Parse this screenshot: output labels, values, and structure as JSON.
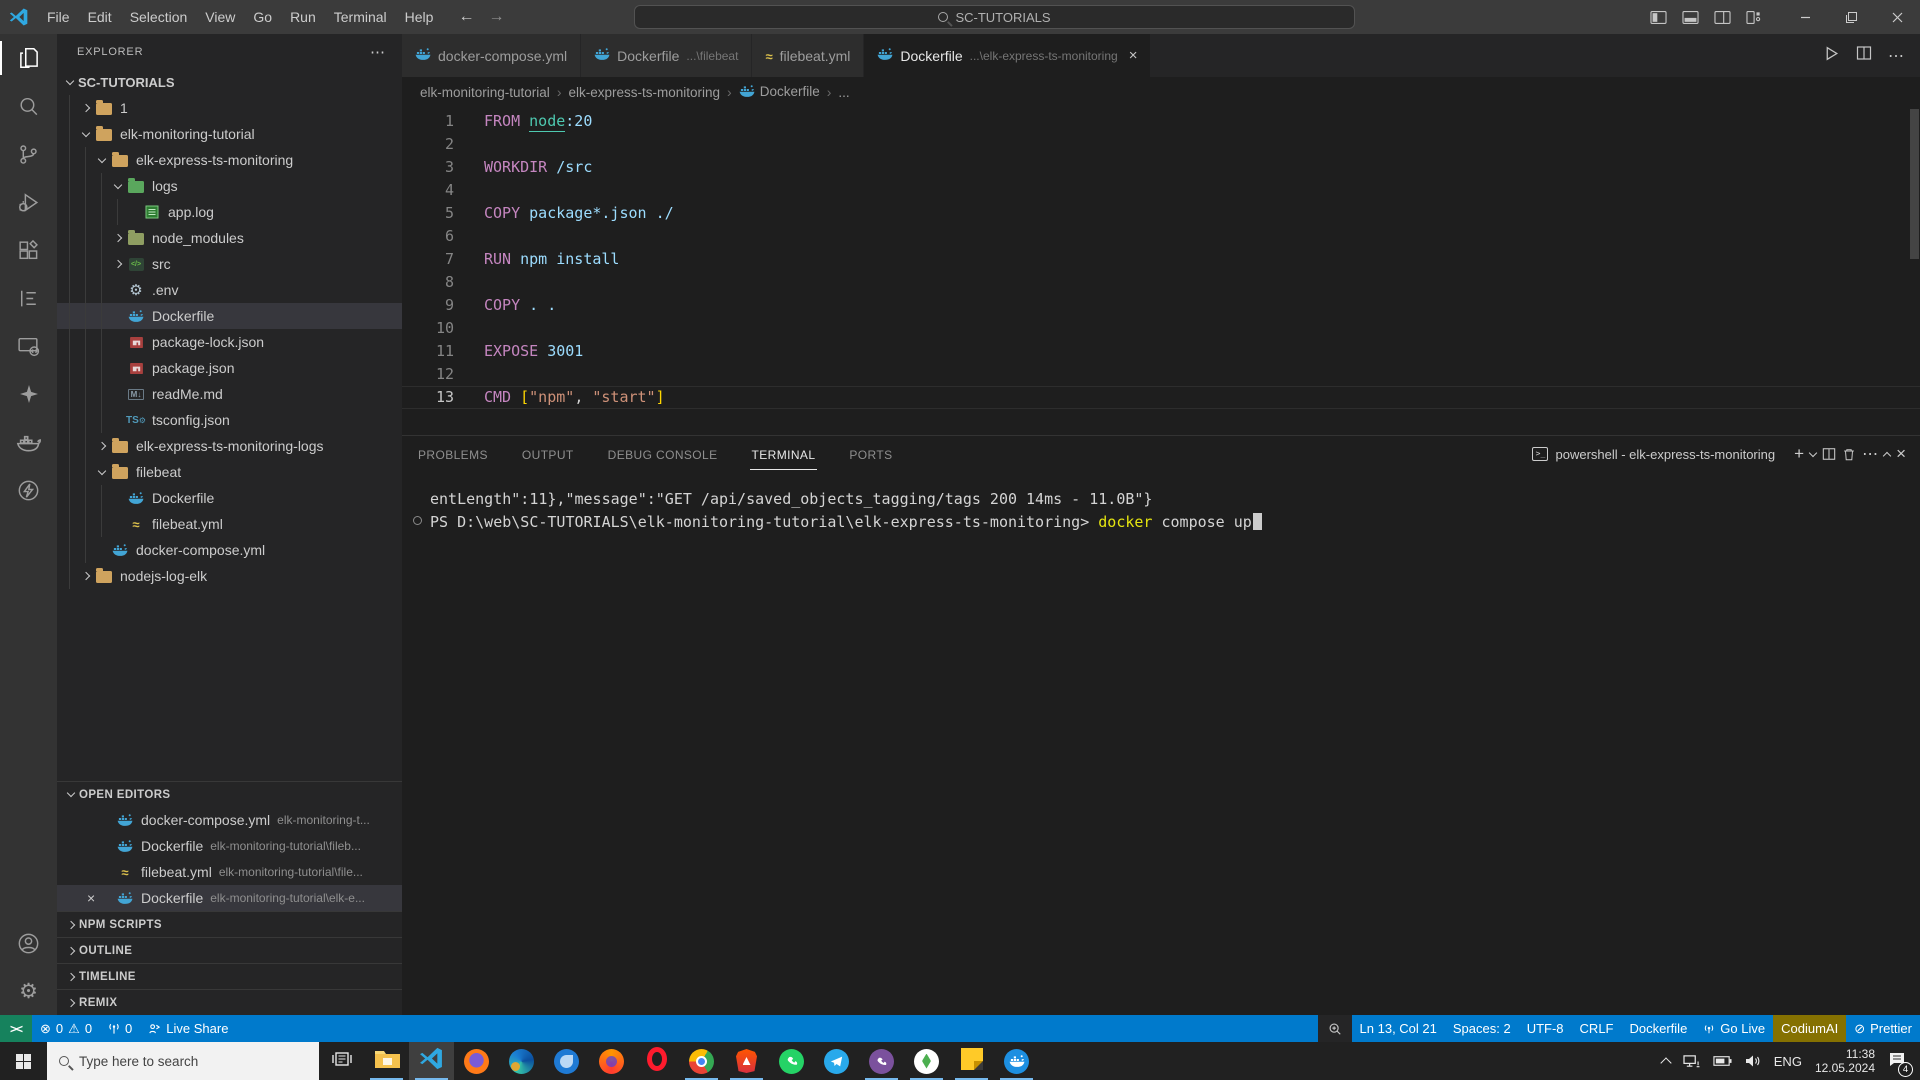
{
  "colors": {
    "accent": "#007acc",
    "remote_bg": "#16825d",
    "codium_bg": "#857101",
    "whale_blue": "#42a5d5",
    "yaml_yellow": "#dcc04c",
    "folder_tan": "#cfa35e",
    "folder_green": "#5aa75d"
  },
  "window": {
    "menus": [
      "File",
      "Edit",
      "Selection",
      "View",
      "Go",
      "Run",
      "Terminal",
      "Help"
    ],
    "search_title": "SC-TUTORIALS",
    "layout_icons": [
      "toggle-primary-sidebar",
      "toggle-panel",
      "toggle-secondary-sidebar",
      "customize-layout"
    ],
    "controls": [
      "minimize",
      "restore",
      "close"
    ]
  },
  "activity_bar": {
    "top": [
      {
        "name": "explorer",
        "active": true
      },
      {
        "name": "search"
      },
      {
        "name": "source-control"
      },
      {
        "name": "run-debug"
      },
      {
        "name": "extensions"
      },
      {
        "name": "outline"
      },
      {
        "name": "remote-explorer"
      },
      {
        "name": "codium"
      },
      {
        "name": "docker"
      },
      {
        "name": "thunder-client"
      }
    ],
    "bottom": [
      {
        "name": "account"
      },
      {
        "name": "settings"
      }
    ]
  },
  "sidebar": {
    "header": "EXPLORER",
    "tree": [
      {
        "label": "SC-TUTORIALS",
        "level": 0,
        "chevron": "down",
        "icon": "none",
        "root": true
      },
      {
        "label": "1",
        "level": 1,
        "chevron": "right",
        "icon": "folder"
      },
      {
        "label": "elk-monitoring-tutorial",
        "level": 1,
        "chevron": "down",
        "icon": "folder"
      },
      {
        "label": "elk-express-ts-monitoring",
        "level": 2,
        "chevron": "down",
        "icon": "folder"
      },
      {
        "label": "logs",
        "level": 3,
        "chevron": "down",
        "icon": "folder-logs"
      },
      {
        "label": "app.log",
        "level": 4,
        "chevron": "none",
        "icon": "log-file"
      },
      {
        "label": "node_modules",
        "level": 3,
        "chevron": "right",
        "icon": "folder-node"
      },
      {
        "label": "src",
        "level": 3,
        "chevron": "right",
        "icon": "folder-src"
      },
      {
        "label": ".env",
        "level": 3,
        "chevron": "none",
        "icon": "gear"
      },
      {
        "label": "Dockerfile",
        "level": 3,
        "chevron": "none",
        "icon": "docker",
        "selected": true
      },
      {
        "label": "package-lock.json",
        "level": 3,
        "chevron": "none",
        "icon": "npm"
      },
      {
        "label": "package.json",
        "level": 3,
        "chevron": "none",
        "icon": "npm"
      },
      {
        "label": "readMe.md",
        "level": 3,
        "chevron": "none",
        "icon": "markdown"
      },
      {
        "label": "tsconfig.json",
        "level": 3,
        "chevron": "none",
        "icon": "ts"
      },
      {
        "label": "elk-express-ts-monitoring-logs",
        "level": 2,
        "chevron": "right",
        "icon": "folder"
      },
      {
        "label": "filebeat",
        "level": 2,
        "chevron": "down",
        "icon": "folder"
      },
      {
        "label": "Dockerfile",
        "level": 3,
        "chevron": "none",
        "icon": "docker"
      },
      {
        "label": "filebeat.yml",
        "level": 3,
        "chevron": "none",
        "icon": "yaml"
      },
      {
        "label": "docker-compose.yml",
        "level": 2,
        "chevron": "none",
        "icon": "docker"
      },
      {
        "label": "nodejs-log-elk",
        "level": 1,
        "chevron": "right",
        "icon": "folder"
      }
    ],
    "open_editors": {
      "header": "OPEN EDITORS",
      "items": [
        {
          "name": "docker-compose.yml",
          "path": "elk-monitoring-t...",
          "icon": "docker"
        },
        {
          "name": "Dockerfile",
          "path": "elk-monitoring-tutorial\\fileb...",
          "icon": "docker"
        },
        {
          "name": "filebeat.yml",
          "path": "elk-monitoring-tutorial\\file...",
          "icon": "yaml"
        },
        {
          "name": "Dockerfile",
          "path": "elk-monitoring-tutorial\\elk-e...",
          "icon": "docker",
          "active": true
        }
      ]
    },
    "sections": [
      "NPM SCRIPTS",
      "OUTLINE",
      "TIMELINE",
      "REMIX"
    ]
  },
  "editor": {
    "tabs": [
      {
        "name": "docker-compose.yml",
        "detail": "",
        "icon": "docker"
      },
      {
        "name": "Dockerfile",
        "detail": "...\\filebeat",
        "icon": "docker"
      },
      {
        "name": "filebeat.yml",
        "detail": "",
        "icon": "yaml"
      },
      {
        "name": "Dockerfile",
        "detail": "...\\elk-express-ts-monitoring",
        "icon": "docker",
        "active": true
      }
    ],
    "breadcrumbs": [
      "elk-monitoring-tutorial",
      "elk-express-ts-monitoring",
      "Dockerfile",
      "..."
    ],
    "actions": [
      "run",
      "split-editor",
      "more"
    ],
    "code_lines": [
      {
        "n": "1",
        "tokens": [
          [
            "FROM ",
            "kw"
          ],
          [
            "node",
            "link"
          ],
          [
            ":20",
            "arg"
          ]
        ]
      },
      {
        "n": "2",
        "tokens": []
      },
      {
        "n": "3",
        "tokens": [
          [
            "WORKDIR ",
            "kw"
          ],
          [
            "/src",
            "arg"
          ]
        ]
      },
      {
        "n": "4",
        "tokens": []
      },
      {
        "n": "5",
        "tokens": [
          [
            "COPY ",
            "kw"
          ],
          [
            "package*.json ./",
            "arg"
          ]
        ]
      },
      {
        "n": "6",
        "tokens": []
      },
      {
        "n": "7",
        "tokens": [
          [
            "RUN ",
            "kw"
          ],
          [
            "npm install",
            "arg"
          ]
        ]
      },
      {
        "n": "8",
        "tokens": []
      },
      {
        "n": "9",
        "tokens": [
          [
            "COPY ",
            "kw"
          ],
          [
            ". .",
            "arg"
          ]
        ]
      },
      {
        "n": "10",
        "tokens": []
      },
      {
        "n": "11",
        "tokens": [
          [
            "EXPOSE ",
            "kw"
          ],
          [
            "3001",
            "arg"
          ]
        ]
      },
      {
        "n": "12",
        "tokens": []
      },
      {
        "n": "13",
        "tokens": [
          [
            "CMD ",
            "kw"
          ],
          [
            "[",
            "br"
          ],
          [
            "\"npm\"",
            "str"
          ],
          [
            ", ",
            "pl"
          ],
          [
            "\"start\"",
            "str"
          ],
          [
            "]",
            "br"
          ]
        ],
        "current": true
      }
    ]
  },
  "panel": {
    "tabs": [
      {
        "label": "PROBLEMS"
      },
      {
        "label": "OUTPUT"
      },
      {
        "label": "DEBUG CONSOLE"
      },
      {
        "label": "TERMINAL",
        "active": true
      },
      {
        "label": "PORTS"
      }
    ],
    "shell_label": "powershell - elk-express-ts-monitoring",
    "actions": [
      "new-terminal",
      "launch-profile-dropdown",
      "split-terminal",
      "kill-terminal",
      "more",
      "maximize-panel",
      "close-panel"
    ],
    "terminal_lines": [
      {
        "tokens": [
          [
            "entLength\":11},\"message\":\"GET /api/saved_objects_tagging/tags 200 14ms - 11.0B\"}",
            "pl"
          ]
        ]
      },
      {
        "decorated": true,
        "cursor": true,
        "tokens": [
          [
            "PS D:\\web\\SC-TUTORIALS\\elk-monitoring-tutorial\\elk-express-ts-monitoring> ",
            "pl"
          ],
          [
            "docker",
            "cmd"
          ],
          [
            " compose up",
            "pl"
          ]
        ]
      }
    ]
  },
  "status_bar": {
    "remote_label": "><",
    "errors": "0",
    "warnings": "0",
    "ports_count": "0",
    "live_share": "Live Share",
    "right_items": [
      {
        "label": "Ln 13, Col 21"
      },
      {
        "label": "Spaces: 2"
      },
      {
        "label": "UTF-8"
      },
      {
        "label": "CRLF"
      },
      {
        "label": "Dockerfile"
      },
      {
        "label": "Go Live",
        "icon": "broadcast"
      },
      {
        "label": "CodiumAI",
        "highlight": true
      },
      {
        "label": "Prettier",
        "icon": "slash-circle"
      }
    ]
  },
  "taskbar": {
    "search_placeholder": "Type here to search",
    "apps": [
      {
        "name": "task-view"
      },
      {
        "name": "file-explorer",
        "running": true
      },
      {
        "name": "vscode",
        "running": true,
        "active": true
      },
      {
        "name": "privacy-browser"
      },
      {
        "name": "edge"
      },
      {
        "name": "thunderbird"
      },
      {
        "name": "firefox"
      },
      {
        "name": "opera"
      },
      {
        "name": "chrome",
        "running": true
      },
      {
        "name": "brave",
        "running": true
      },
      {
        "name": "whatsapp"
      },
      {
        "name": "telegram"
      },
      {
        "name": "viber",
        "running": true
      },
      {
        "name": "mongodb",
        "running": true
      },
      {
        "name": "sticky-notes",
        "running": true
      },
      {
        "name": "docker-desktop",
        "running": true
      }
    ],
    "tray": {
      "language": "ENG",
      "time": "11:38",
      "date": "12.05.2024",
      "notifications": "4"
    }
  }
}
